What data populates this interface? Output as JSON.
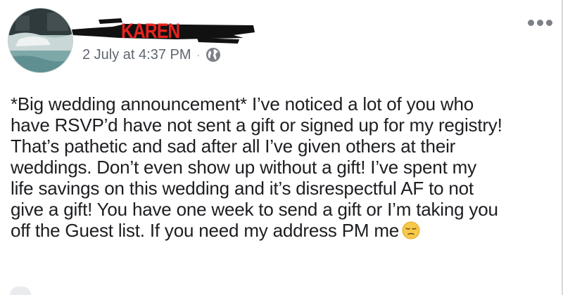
{
  "post": {
    "author_name": "KAREN",
    "timestamp": "2 July at 4:37 PM",
    "separator": "·",
    "privacy_icon": "globe-icon",
    "more_icon": "more-options-icon",
    "body_lines": [
      "*Big wedding announcement* I’ve noticed a lot of you who",
      "have RSVP’d have not sent a gift or signed up for my registry!",
      "That’s pathetic and sad after all I’ve given others at their",
      "weddings. Don’t even show up without a gift! I’ve spent my",
      "life savings on this wedding and it’s disrespectful AF to not",
      "give a gift! You have one week to send a gift or I’m taking you",
      "off the Guest list. If you need my address PM me"
    ],
    "trailing_emoji": "pensive-face-emoji"
  },
  "colors": {
    "name_red": "#e8231f",
    "scribble_black": "#111111",
    "meta_gray": "#606770",
    "text": "#1c1e21",
    "emoji_yellow": "#f7c948"
  }
}
